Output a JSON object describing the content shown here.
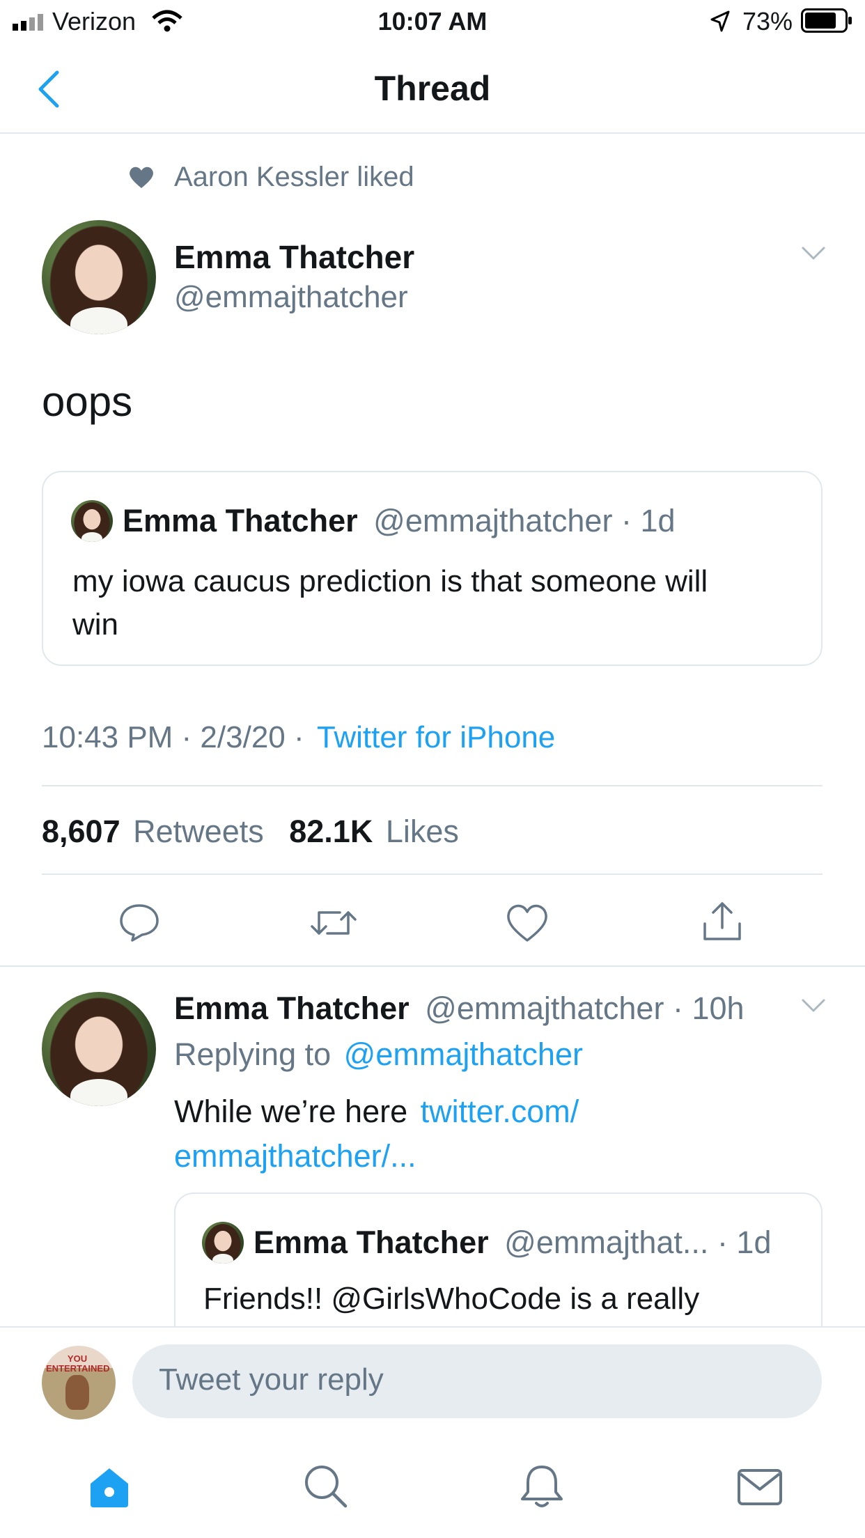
{
  "status_bar": {
    "carrier": "Verizon",
    "time": "10:07 AM",
    "battery": "73%"
  },
  "nav": {
    "title": "Thread"
  },
  "social_context": {
    "text": "Aaron Kessler liked"
  },
  "main_tweet": {
    "name": "Emma Thatcher",
    "handle": "@emmajthatcher",
    "text": "oops",
    "quoted": {
      "name": "Emma Thatcher",
      "handle": "@emmajthatcher",
      "time": "· 1d",
      "text_line1": "my iowa caucus prediction is that someone will",
      "text_line2": "win"
    },
    "timestamp": "10:43 PM · 2/3/20 ·",
    "source": "Twitter for iPhone",
    "retweets_count": "8,607",
    "retweets_label": "Retweets",
    "likes_count": "82.1K",
    "likes_label": "Likes"
  },
  "reply_tweet": {
    "name": "Emma Thatcher",
    "handle": "@emmajthatcher",
    "time": "· 10h",
    "replying_prefix": "Replying to",
    "replying_handle": "@emmajthatcher",
    "text_prefix": "While we’re here",
    "link_line1": "twitter.com/",
    "link_line2": "emmajthatcher/...",
    "quoted": {
      "name": "Emma Thatcher",
      "handle": "@emmajthat...",
      "time": "· 1d",
      "text": "Friends!! @GirlsWhoCode is a really"
    }
  },
  "composer": {
    "placeholder": "Tweet your reply"
  },
  "icons": {
    "back": "chevron-left-icon",
    "like_context": "heart-filled-icon",
    "reply": "reply-icon",
    "retweet": "retweet-icon",
    "like": "heart-icon",
    "share": "share-icon",
    "home": "home-icon",
    "search": "search-icon",
    "notifications": "bell-icon",
    "messages": "mail-icon"
  },
  "colors": {
    "accent": "#1da1f2",
    "muted": "#657786",
    "divider": "#e1e8ed"
  }
}
